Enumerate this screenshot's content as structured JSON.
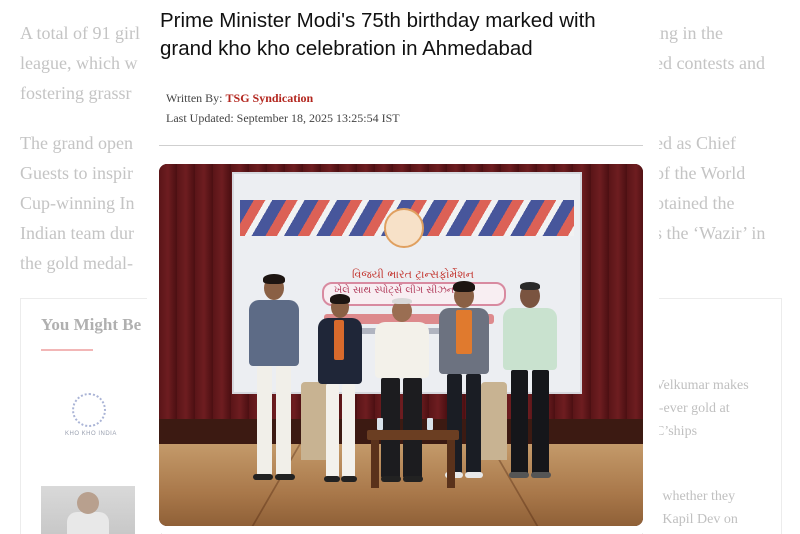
{
  "background_article": {
    "left_lines": [
      "A total of 91 girl",
      "league, which w",
      "fostering grassr"
    ],
    "right_lines": [
      "ing in the",
      "ed contests and"
    ],
    "para2_left": [
      "The grand open",
      "Guests to inspir",
      "Cup-winning In",
      "Indian team dur",
      "the gold medal-"
    ],
    "para2_right": [
      "ed as Chief",
      "of the World",
      "otained the",
      "s the ‘Wazir’ in"
    ],
    "you_might_be": "You Might Be",
    "logo_caption": "KHO KHO INDIA",
    "right_card_lines": [
      "Velkumar makes",
      "t-ever gold at",
      "C’ships"
    ],
    "right_card_lines2": [
      ": whether they",
      ": Kapil Dev on"
    ]
  },
  "popup": {
    "headline": "Prime Minister Modi's 75th birthday marked with grand kho kho celebration in Ahmedabad",
    "written_by_label": "Written By: ",
    "author": "TSG Syndication",
    "last_updated": "Last Updated: September 18, 2025 13:25:54 IST"
  },
  "photo": {
    "screen_title": "વિજયી ભારત ટ્રાન્સફોર્મેશન",
    "screen_pill": "ખેલે સાથ સ્પોર્ટ્સ લીગ સીઝન 3"
  },
  "colors": {
    "author": "#b3261e",
    "curtain": "#5a1518",
    "faded_text": "#c4c4c4"
  }
}
